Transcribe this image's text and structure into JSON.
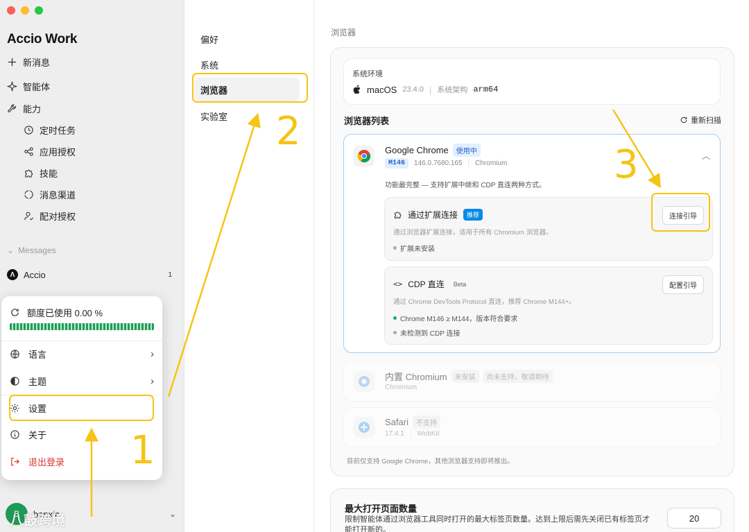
{
  "app": {
    "title": "Accio Work"
  },
  "sidebar": {
    "new_message": "新消息",
    "items": [
      {
        "label": "智能体"
      },
      {
        "label": "能力"
      }
    ],
    "sub_items": [
      {
        "label": "定时任务"
      },
      {
        "label": "应用授权"
      },
      {
        "label": "技能"
      },
      {
        "label": "消息渠道"
      },
      {
        "label": "配对授权"
      }
    ],
    "messages_label": "Messages",
    "messages": [
      {
        "name": "Accio",
        "count": "1"
      }
    ],
    "user": {
      "name": "banxia",
      "avatar_text": "B"
    }
  },
  "popup": {
    "quota": "额度已使用 0.00 %",
    "quota_fraction": 0.0,
    "items": [
      {
        "label": "语言"
      },
      {
        "label": "主题"
      },
      {
        "label": "设置"
      },
      {
        "label": "关于"
      },
      {
        "label": "退出登录"
      }
    ]
  },
  "settings_nav": [
    {
      "label": "偏好"
    },
    {
      "label": "系统"
    },
    {
      "label": "浏览器"
    },
    {
      "label": "实验室"
    }
  ],
  "main": {
    "page_title": "浏览器",
    "env": {
      "label": "系统环境",
      "os": "macOS",
      "os_version": "23.4.0",
      "arch_label": "系统架构",
      "arch": "arm64"
    },
    "list_title": "浏览器列表",
    "rescan": "重新扫描",
    "chrome": {
      "name": "Google Chrome",
      "status": "使用中",
      "major": "M146",
      "version": "146.0.7680.165",
      "engine": "Chromium",
      "desc": "功能最完整 — 支持扩展中继和 CDP 直连两种方式。",
      "ext": {
        "title": "通过扩展连接",
        "badge": "推荐",
        "sub": "通过浏览器扩展连接，适用于所有 Chromium 浏览器。",
        "status": "扩展未安装",
        "button": "连接引导"
      },
      "cdp": {
        "title": "CDP 直连",
        "badge": "Beta",
        "sub": "通过 Chrome DevTools Protocol 直连，推荐 Chrome M144+。",
        "status1": "Chrome M146 ≥ M144，版本符合要求",
        "status2": "未检测到 CDP 连接",
        "button": "配置引导"
      }
    },
    "chromium": {
      "name": "内置 Chromium",
      "badge1": "未安装",
      "badge2": "尚未支持，敬请期待",
      "engine": "Chromium"
    },
    "safari": {
      "name": "Safari",
      "badge": "不支持",
      "version": "17.4.1",
      "engine": "WebKit"
    },
    "footnote": "目前仅支持 Google Chrome，其他浏览器支持即将推出。",
    "max_pages": {
      "title": "最大打开页面数量",
      "desc": "限制智能体通过浏览器工具同时打开的最大标签页数量。达到上限后需先关闭已有标签页才能打开新的。",
      "value": "20"
    }
  },
  "annotations": {
    "n1": "1",
    "n2": "2",
    "n3": "3",
    "color": "#f5c414"
  },
  "watermark": "八鼓跨境"
}
